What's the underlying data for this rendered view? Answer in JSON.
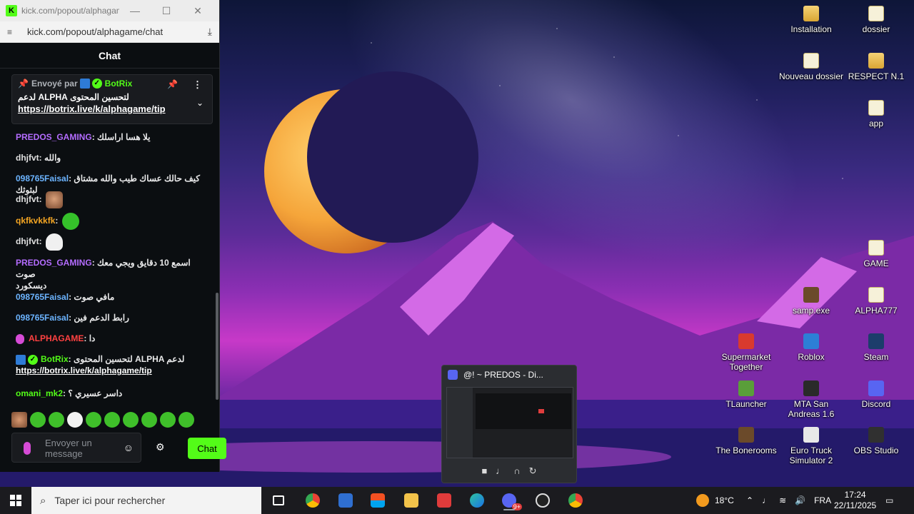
{
  "browser": {
    "title": "kick.com/popout/alphagam...",
    "url": "kick.com/popout/alphagame/chat"
  },
  "chat": {
    "header": "Chat",
    "pinned": {
      "sent_by_label": "Envoyé par",
      "user": "BotRix",
      "message": "لتحسين المحتوى ALPHA لدعم",
      "link": "https://botrix.live/k/alphagame/tip"
    },
    "messages": [
      {
        "user": "PREDOS_GAMING",
        "text": "يلا هسا اراسلك"
      },
      {
        "user": "dhjfvt",
        "text": "والله"
      },
      {
        "user": "098765Faisal",
        "text": "كيف حالك عساك طيب والله مشتاق لبثوثك"
      },
      {
        "user": "dhjfvt",
        "text": ""
      },
      {
        "user": "qkfkvkkfk",
        "text": ""
      },
      {
        "user": "dhjfvt",
        "text": ""
      },
      {
        "user": "PREDOS_GAMING",
        "text": "اسمع 10 دقايق ويجي معك صوت",
        "text2": "ديسكورد"
      },
      {
        "user": "098765Faisal",
        "text": "مافي صوت"
      },
      {
        "user": "098765Faisal",
        "text": "رابط الدعم فين"
      },
      {
        "user": "ALPHAGAME",
        "text": "دا"
      },
      {
        "user": "BotRix",
        "text": "لتحسين المحتوى ALPHA لدعم",
        "link": "https://botrix.live/k/alphagame/tip"
      },
      {
        "user": "omani_mk2",
        "text": "داسر عسيري ؟"
      }
    ],
    "input_placeholder": "Envoyer un message",
    "send_label": "Chat"
  },
  "desktop_icons": [
    {
      "label": "Installation",
      "icon": "folder-icon"
    },
    {
      "label": "dossier",
      "icon": "file-icon"
    },
    {
      "label": "Nouveau dossier",
      "icon": "file-icon"
    },
    {
      "label": "RESPECT N.1",
      "icon": "folder-icon"
    },
    {
      "label": "app",
      "icon": "file-icon"
    },
    {
      "label": "GAME",
      "icon": "file-icon"
    },
    {
      "label": "samp.exe",
      "icon": "app-icon"
    },
    {
      "label": "ALPHA777",
      "icon": "file-icon"
    },
    {
      "label": "Supermarket Together",
      "icon": "app-icon"
    },
    {
      "label": "Roblox",
      "icon": "roblox-icon"
    },
    {
      "label": "Steam",
      "icon": "steam-icon"
    },
    {
      "label": "TLauncher",
      "icon": "tlauncher-icon"
    },
    {
      "label": "MTA San Andreas 1.6",
      "icon": "mta-icon"
    },
    {
      "label": "Discord",
      "icon": "discord-icon"
    },
    {
      "label": "The Bonerooms",
      "icon": "app-icon"
    },
    {
      "label": "Euro Truck Simulator 2",
      "icon": "app-icon"
    },
    {
      "label": "OBS Studio",
      "icon": "obs-icon"
    }
  ],
  "discord_preview": {
    "title": "@! ~ PREDOS - Di..."
  },
  "taskbar": {
    "search_placeholder": "Taper ici pour rechercher",
    "weather": "18°C",
    "language": "FRA",
    "time": "17:24",
    "date": "22/11/2025",
    "discord_badge": "9+"
  },
  "colors": {
    "kick_green": "#53fc18",
    "chat_bg": "#0b0e11",
    "taskbar_bg": "#1b1b1f"
  }
}
